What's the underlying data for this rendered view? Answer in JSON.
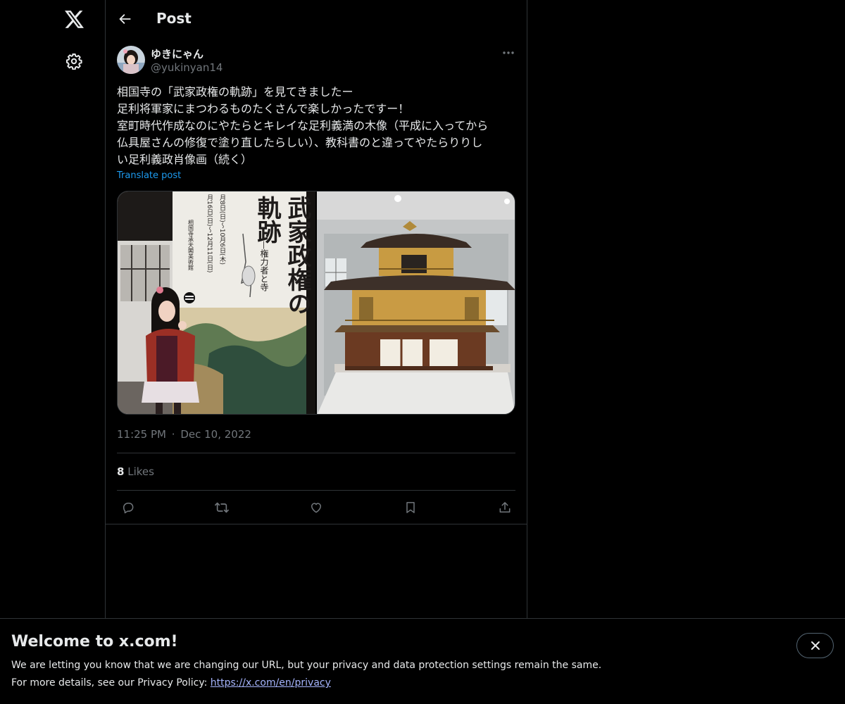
{
  "nav": {
    "logo_icon": "x-logo-icon",
    "settings_icon": "gear-icon"
  },
  "header": {
    "back_icon": "arrow-left-icon",
    "title": "Post"
  },
  "post": {
    "author": {
      "name": "ゆきにゃん",
      "handle": "@yukinyan14"
    },
    "text_lines": [
      "相国寺の「武家政権の軌跡」を見てきましたー",
      "足利将軍家にまつわるものたくさんで楽しかったですー！",
      "室町時代作成なのにやたらとキレイな足利義満の木像（平成に入ってから",
      "仏具屋さんの修復で塗り直したらしい）、教科書のと違ってやたらりりし",
      "い足利義政肖像画（続く）"
    ],
    "translate_label": "Translate post",
    "poster_text": {
      "title_col1": "武家政権の",
      "title_col2": "軌跡",
      "subtitle": "—権力者と寺",
      "dates": [
        "月8日(日)〜10月6日(木)",
        "月16日(日)〜12月11日(日)"
      ],
      "venue": "相国寺承天閣美術館"
    },
    "time": "11:25 PM",
    "separator": "·",
    "date": "Dec 10, 2022",
    "likes_count": "8",
    "likes_label": "Likes"
  },
  "actions": {
    "reply_icon": "reply-icon",
    "repost_icon": "repost-icon",
    "like_icon": "heart-icon",
    "bookmark_icon": "bookmark-icon",
    "share_icon": "share-icon"
  },
  "banner": {
    "title": "Welcome to x.com!",
    "line1": "We are letting you know that we are changing our URL, but your privacy and data protection settings remain the same.",
    "line2_prefix": "For more details, see our Privacy Policy: ",
    "line2_link": "https://x.com/en/privacy",
    "close_icon": "close-icon"
  },
  "colors": {
    "background": "#000000",
    "text": "#e7e9ea",
    "secondary_text": "#71767b",
    "link": "#1d9bf0",
    "border": "#2f3336"
  }
}
